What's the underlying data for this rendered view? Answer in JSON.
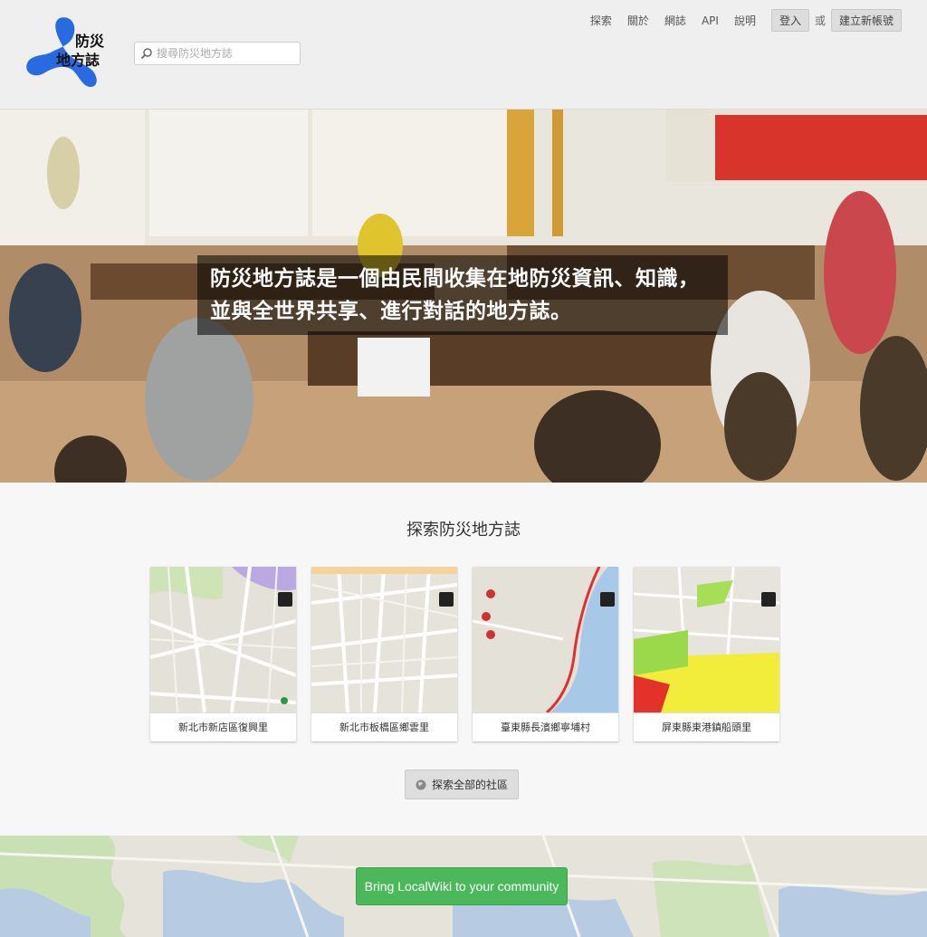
{
  "header": {
    "logo_line1": "防災",
    "logo_line2": "地方誌",
    "search_placeholder": "搜尋防災地方誌",
    "nav": [
      "探索",
      "關於",
      "網誌",
      "API",
      "說明"
    ],
    "login_label": "登入",
    "or_label": "或",
    "signup_label": "建立新帳號"
  },
  "hero": {
    "caption": "防災地方誌是一個由民間收集在地防災資訊、知識，並與全世界共享、進行對話的地方誌。"
  },
  "explore": {
    "title": "探索防災地方誌",
    "cards": [
      {
        "label": "新北市新店區復興里"
      },
      {
        "label": "新北市板橋區鄉雲里"
      },
      {
        "label": "臺東縣長濱鄉寧埔村"
      },
      {
        "label": "屏東縣東港鎮船頭里"
      }
    ],
    "explore_all_label": "探索全部的社區"
  },
  "cta": {
    "label": "Bring LocalWiki to your community"
  },
  "colors": {
    "accent_green": "#4cb85c",
    "logo_blue": "#2a6ae0"
  }
}
